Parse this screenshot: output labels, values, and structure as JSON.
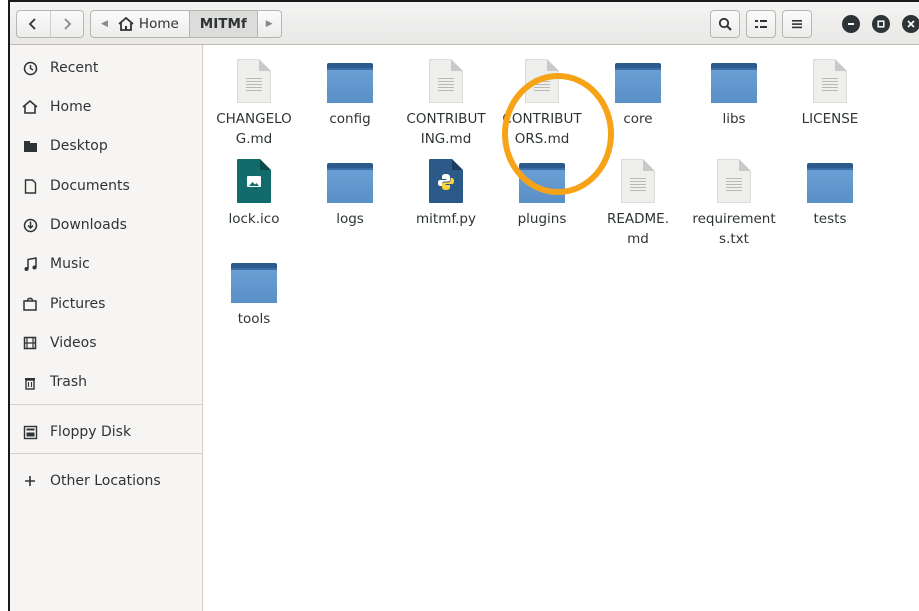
{
  "header": {
    "back_icon": "go-back-icon",
    "forward_icon": "go-forward-icon",
    "breadcrumbs": [
      {
        "label": "Home",
        "icon": "home-icon"
      },
      {
        "label": "MITMf"
      }
    ],
    "buttons": [
      "search-icon",
      "view-icon",
      "menu-icon"
    ],
    "window_controls": [
      "minimize-icon",
      "maximize-icon",
      "close-icon"
    ]
  },
  "sidebar": {
    "items": [
      {
        "label": "Recent",
        "icon": "clock-icon"
      },
      {
        "label": "Home",
        "icon": "home-icon"
      },
      {
        "label": "Desktop",
        "icon": "folder-icon"
      },
      {
        "label": "Documents",
        "icon": "document-icon"
      },
      {
        "label": "Downloads",
        "icon": "download-icon"
      },
      {
        "label": "Music",
        "icon": "music-icon"
      },
      {
        "label": "Pictures",
        "icon": "camera-icon"
      },
      {
        "label": "Videos",
        "icon": "film-icon"
      },
      {
        "label": "Trash",
        "icon": "trash-icon"
      },
      {
        "label": "Floppy Disk",
        "icon": "floppy-icon"
      },
      {
        "label": "Other Locations",
        "icon": "plus-icon"
      }
    ]
  },
  "files": [
    {
      "name": "CHANGELO\nG.md",
      "type": "document"
    },
    {
      "name": "config",
      "type": "folder"
    },
    {
      "name": "CONTRIBUT\nING.md",
      "type": "document"
    },
    {
      "name": "CONTRIBUT\nORS.md",
      "type": "document"
    },
    {
      "name": "core",
      "type": "folder"
    },
    {
      "name": "libs",
      "type": "folder"
    },
    {
      "name": "LICENSE",
      "type": "document"
    },
    {
      "name": "lock.ico",
      "type": "image"
    },
    {
      "name": "logs",
      "type": "folder"
    },
    {
      "name": "mitmf.py",
      "type": "python"
    },
    {
      "name": "plugins",
      "type": "folder"
    },
    {
      "name": "README.\nmd",
      "type": "document"
    },
    {
      "name": "requirement\ns.txt",
      "type": "document"
    },
    {
      "name": "tests",
      "type": "folder"
    },
    {
      "name": "tools",
      "type": "folder"
    }
  ],
  "colors": {
    "folder": "#5a8fc7",
    "highlight": "#f7a318",
    "image_file": "#116a6c",
    "python_file": "#2c5a88"
  }
}
